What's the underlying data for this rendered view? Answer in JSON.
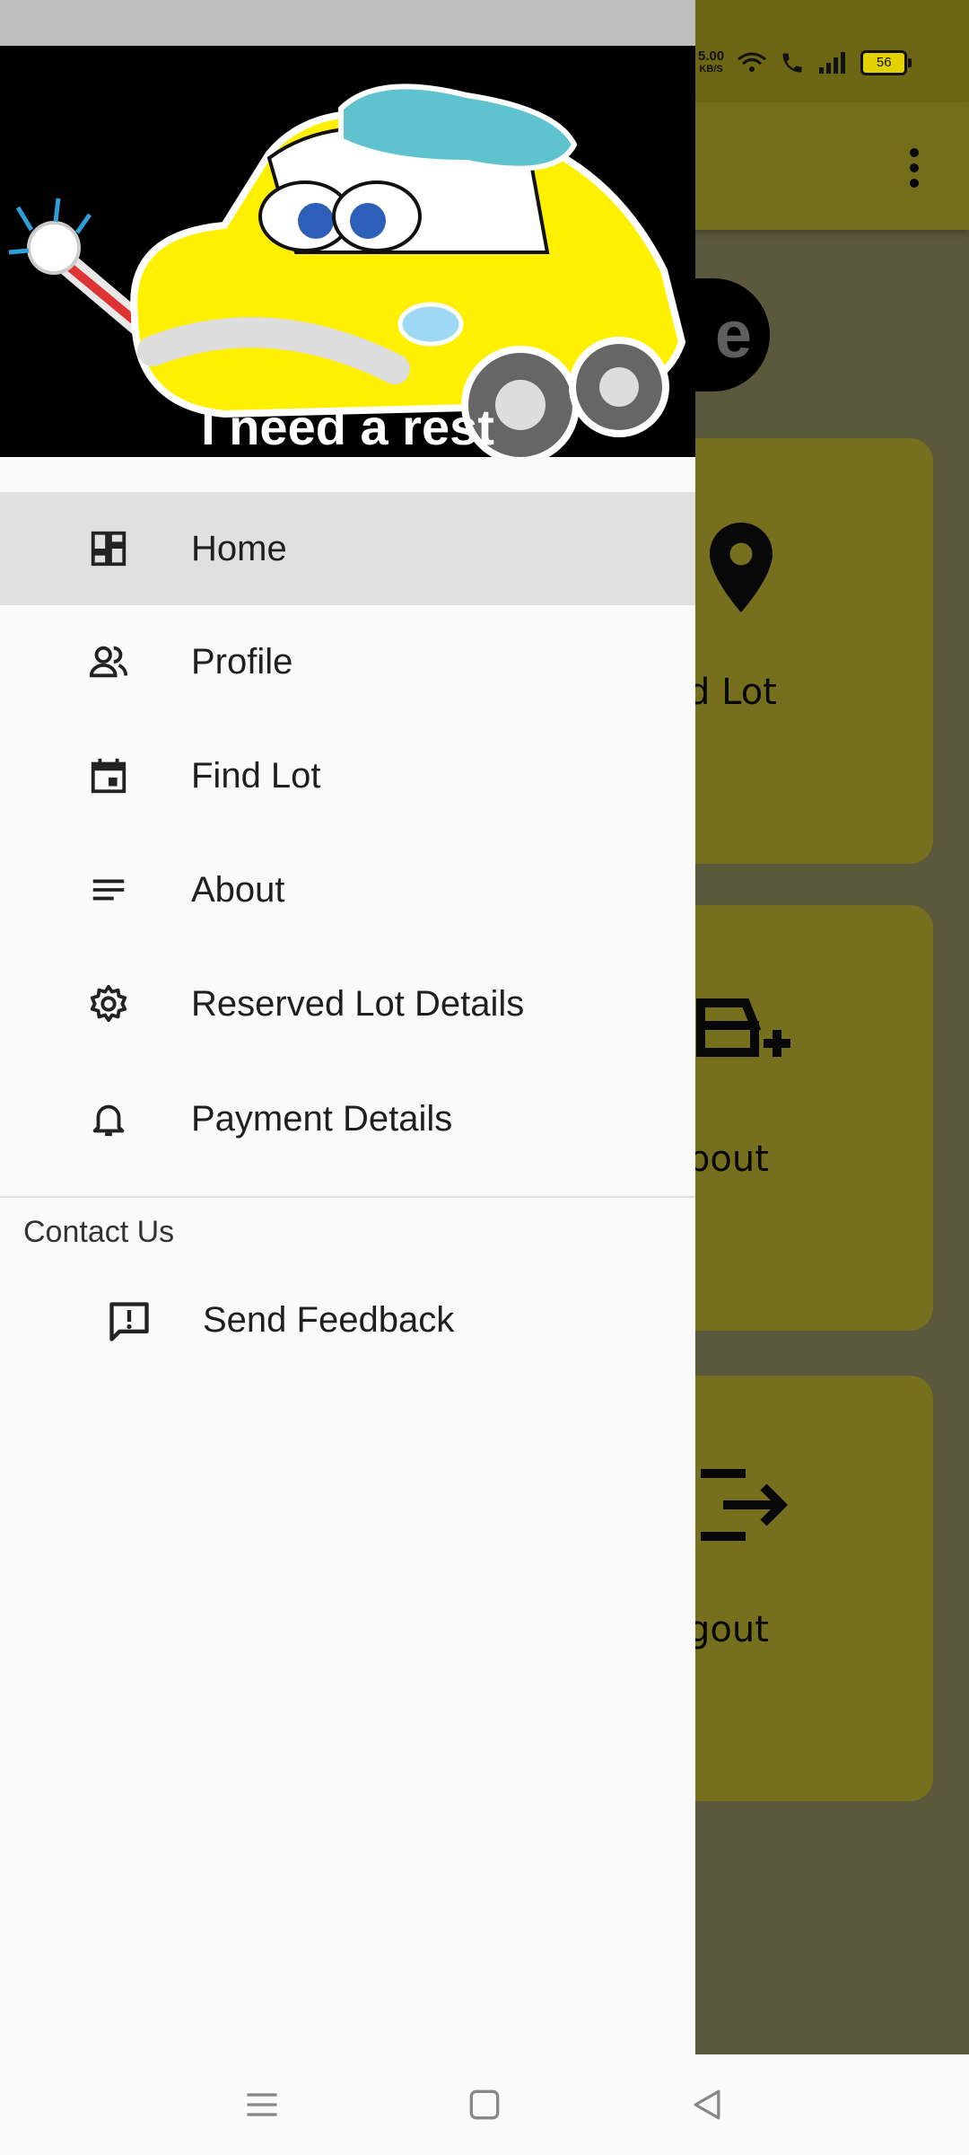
{
  "background": {
    "chip_text": "e",
    "cards": [
      {
        "label": "d Lot",
        "icon": "location-pin-icon"
      },
      {
        "label": "bout",
        "icon": "car-add-icon"
      },
      {
        "label": "gout",
        "icon": "logout-icon"
      }
    ],
    "more_icon": "more-vert-icon",
    "colors": {
      "appbar": "#e9dc36",
      "card": "#ece03c",
      "chip": "#000000"
    }
  },
  "status_bar": {
    "speed_value": "5.00",
    "speed_unit": "KB/S",
    "battery": "56"
  },
  "drawer": {
    "header_caption": "I need a rest",
    "items": [
      {
        "label": "Home",
        "icon": "dashboard-icon",
        "active": true
      },
      {
        "label": "Profile",
        "icon": "people-icon"
      },
      {
        "label": "Find Lot",
        "icon": "calendar-icon"
      },
      {
        "label": "About",
        "icon": "notes-icon"
      },
      {
        "label": "Reserved Lot Details",
        "icon": "gear-icon"
      },
      {
        "label": "Payment Details",
        "icon": "bell-icon"
      }
    ],
    "section_title": "Contact Us",
    "feedback_label": "Send Feedback",
    "feedback_icon": "feedback-icon",
    "colors": {
      "active_bg": "#e0e0e0",
      "header_bg": "#000000"
    }
  },
  "nav_bar": {
    "buttons": [
      "menu-icon",
      "home-square-icon",
      "back-triangle-icon"
    ]
  }
}
